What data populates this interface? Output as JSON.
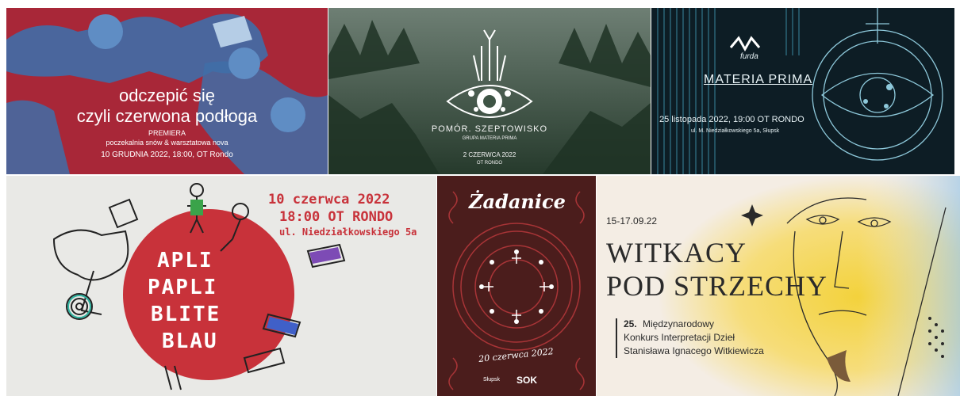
{
  "tiles": [
    {
      "title_line1": "odczepić się",
      "title_line2": "czyli czerwona podłoga",
      "label": "PREMIERA",
      "subtitle": "poczekalnia snów & warsztatowa nova",
      "date": "10 GRUDNIA 2022, 18:00, OT Rondo",
      "colors": {
        "background": "#a82738",
        "figures": "#3f6ea8"
      }
    },
    {
      "title": "POMÓR. SZEPTOWISKO",
      "group": "GRUPA MATERIA PRIMA",
      "date": "2 CZERWCA 2022",
      "venue": "OT RONDO",
      "colors": {
        "background": "#3e5445"
      }
    },
    {
      "logo_text": "furda",
      "title": "MATERIA PRIMA",
      "date": "25 listopada 2022, 19:00 OT RONDO",
      "address": "ul. M. Niedziałkowskiego 5a, Słupsk",
      "colors": {
        "background": "#0d1d25",
        "lines": "#3f93ad"
      }
    },
    {
      "date": "10 czerwca 2022",
      "time": "18:00 OT RONDO",
      "address": "ul. Niedziałkowskiego 5a",
      "title_words": [
        "APLI",
        "PAPLI",
        "BLITE",
        "BLAU"
      ],
      "colors": {
        "background": "#e9e9e6",
        "circle": "#c8323a"
      }
    },
    {
      "title": "Żadanice",
      "date_line": "20 czerwca 2022",
      "sponsors": [
        "Słupsk",
        "SOK"
      ],
      "colors": {
        "background": "#4b1d1c",
        "ornament": "#b3373a"
      }
    },
    {
      "dates": "15-17.09.22",
      "title_line1": "WITKACY",
      "title_line2": "POD STRZECHY",
      "edition": "25.",
      "desc_line1": "Międzynarodowy",
      "desc_line2": "Konkurs Interpretacji Dzieł",
      "desc_line3": "Stanisława Ignacego Witkiewicza",
      "colors": {
        "background": "#f4ede4",
        "yellow": "#f3d23c"
      }
    }
  ]
}
